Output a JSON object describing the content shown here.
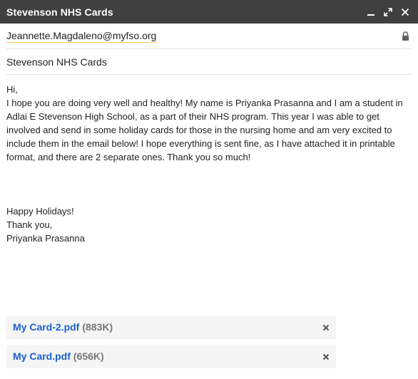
{
  "window": {
    "title": "Stevenson NHS Cards",
    "controls": [
      "minimize-icon",
      "expand-icon",
      "close-icon"
    ]
  },
  "compose": {
    "to": "Jeannette.Magdaleno@myfso.org",
    "subject": "Stevenson NHS Cards",
    "body_para1": "Hi,\nI hope you are doing very well and healthy! My name is Priyanka Prasanna and I am a student in\nAdlai E Stevenson High School, as a part of their NHS program. This year I was able to get\ninvolved and send in some holiday cards for those in the nursing home and am very excited to\ninclude them in the email below! I hope everything is sent fine, as I have attached it in printable\nformat, and there are 2 separate ones. Thank you so much!",
    "body_para2": "Happy Holidays!\nThank you,\nPriyanka Prasanna"
  },
  "attachments": [
    {
      "name": "My Card-2.pdf",
      "size": "(883K)"
    },
    {
      "name": "My Card.pdf",
      "size": "(656K)"
    }
  ],
  "colors": {
    "titlebar": "#404040",
    "link": "#1a5fcf",
    "attachment_bg": "#f5f5f5",
    "recipient_underline": "#f2c25a"
  }
}
